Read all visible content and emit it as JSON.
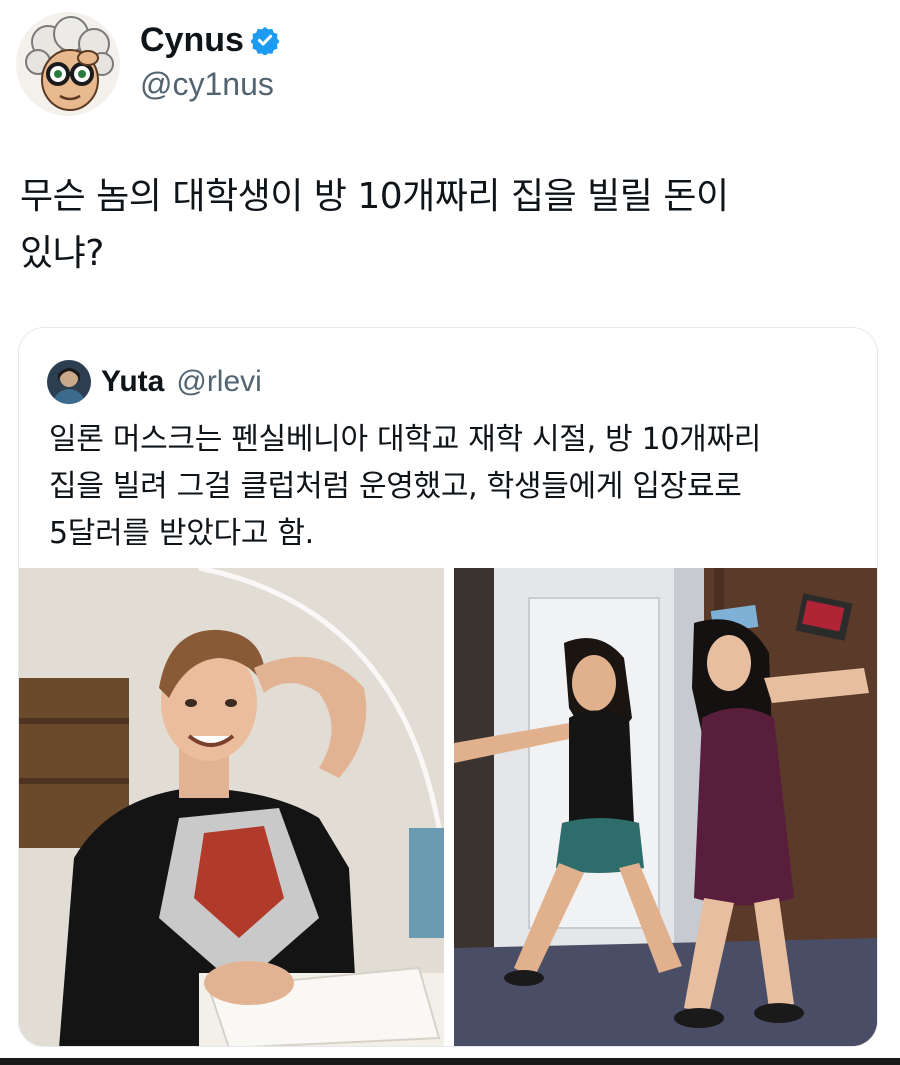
{
  "author": {
    "display_name": "Cynus",
    "handle": "@cy1nus",
    "verified": true,
    "avatar_icon": "cartoon-avatar-icon",
    "verified_icon": "verified-badge-icon",
    "verified_color": "#1d9bf0"
  },
  "tweet": {
    "text_line1": "무슨 놈의 대학생이 방 10개짜리 집을 빌릴 돈이",
    "text_line2": "있냐?"
  },
  "quoted": {
    "display_name": "Yuta",
    "handle": "@rlevi",
    "avatar_icon": "profile-avatar-icon",
    "text_line1": "일론 머스크는 펜실베니아 대학교 재학 시절, 방 10개짜리",
    "text_line2": "집을 빌려 그걸 클럽처럼 운영했고, 학생들에게 입장료로",
    "text_line3": "5달러를 받았다고 함.",
    "photos": [
      {
        "icon": "photo-young-man-at-desk"
      },
      {
        "icon": "photo-two-women-posing"
      }
    ]
  },
  "colors": {
    "text_primary": "#0f1419",
    "text_secondary": "#536471",
    "border": "#e6e9eb"
  }
}
